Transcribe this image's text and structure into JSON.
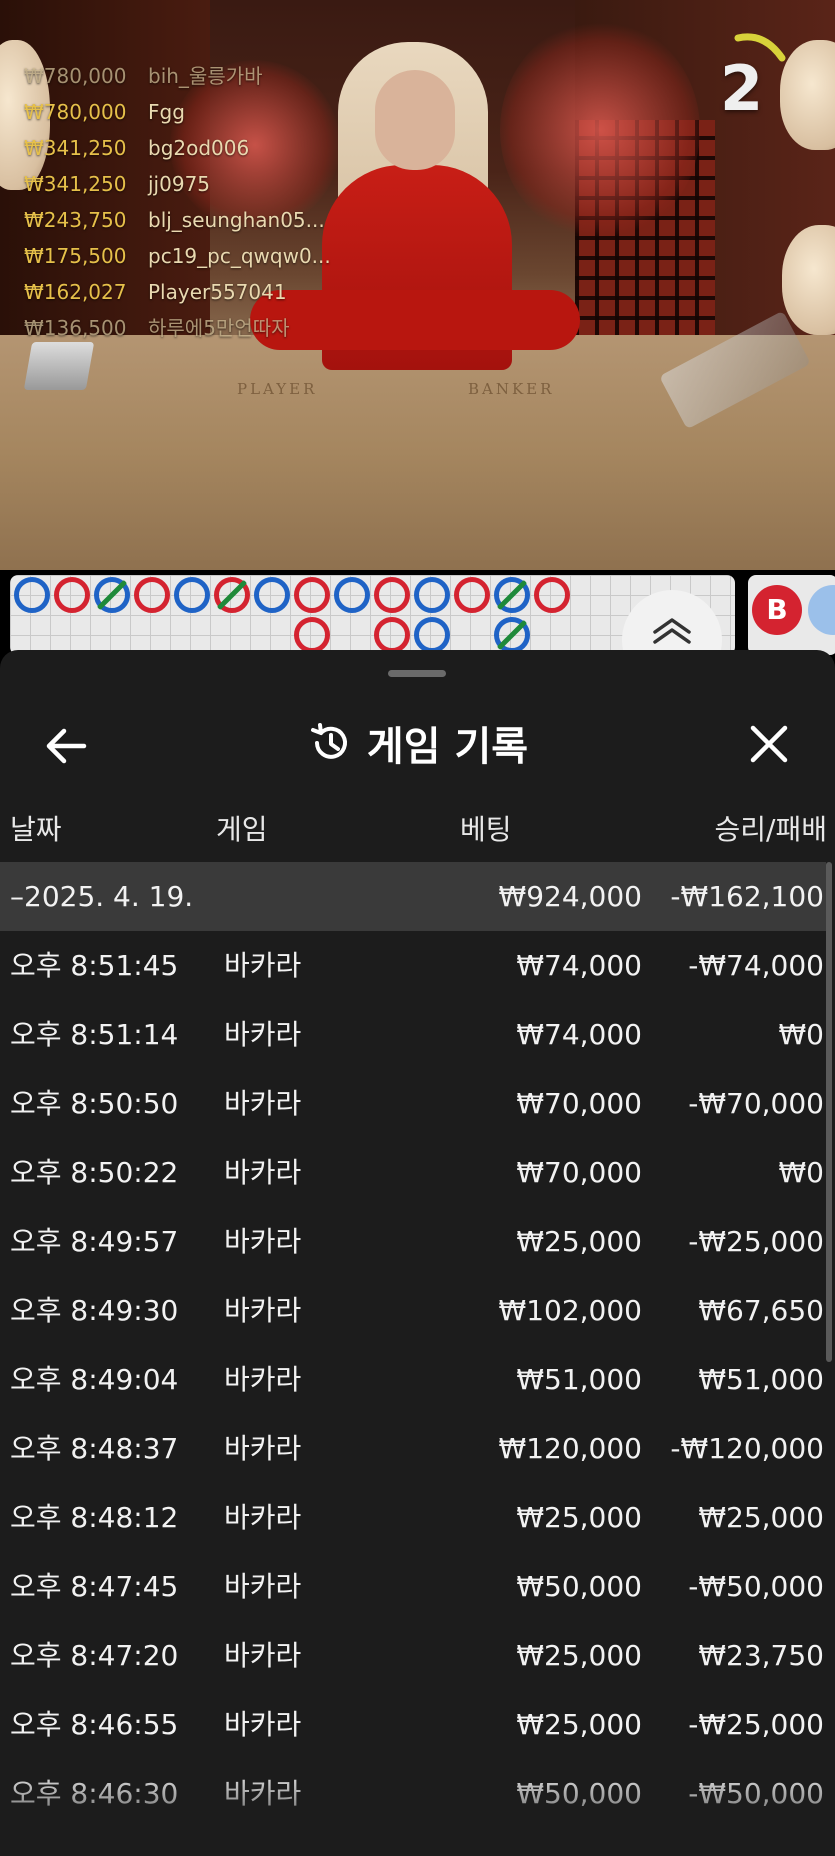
{
  "stream": {
    "countdown": "2",
    "table_labels": {
      "player": "PLAYER",
      "banker": "BANKER"
    },
    "leaderboard": [
      {
        "amount": "₩780,000",
        "name": "bih_울릉가바",
        "dim": true
      },
      {
        "amount": "₩780,000",
        "name": "Fgg",
        "dim": false
      },
      {
        "amount": "₩341,250",
        "name": "bg2od006",
        "dim": false
      },
      {
        "amount": "₩341,250",
        "name": "jj0975",
        "dim": false
      },
      {
        "amount": "₩243,750",
        "name": "blj_seunghan05...",
        "dim": false
      },
      {
        "amount": "₩175,500",
        "name": "pc19_pc_qwqw0...",
        "dim": false
      },
      {
        "amount": "₩162,027",
        "name": "Player557041",
        "dim": false
      },
      {
        "amount": "₩136,500",
        "name": "하루에5만언따자",
        "dim": true
      }
    ],
    "road": {
      "top_row": [
        "p",
        "b",
        "p-tie",
        "b",
        "p",
        "b-tie",
        "p",
        "b",
        "p",
        "b",
        "p",
        "b",
        "p-tie",
        "b"
      ],
      "second_row": [
        "",
        "",
        "",
        "",
        "",
        "",
        "",
        "b",
        "",
        "b",
        "p",
        "",
        "p-tie",
        ""
      ],
      "banker_chip_label": "B"
    }
  },
  "history": {
    "title": "게임 기록",
    "icons": {
      "back": "arrow-left-icon",
      "history": "history-clock-icon",
      "close": "close-icon"
    },
    "columns": {
      "date": "날짜",
      "game": "게임",
      "bet": "베팅",
      "result": "승리/패배"
    },
    "group": {
      "date": "–2025. 4. 19.",
      "bet": "₩924,000",
      "result": "-₩162,100"
    },
    "rows": [
      {
        "time": "오후 8:51:45",
        "game": "바카라",
        "bet": "₩74,000",
        "result": "-₩74,000"
      },
      {
        "time": "오후 8:51:14",
        "game": "바카라",
        "bet": "₩74,000",
        "result": "₩0"
      },
      {
        "time": "오후 8:50:50",
        "game": "바카라",
        "bet": "₩70,000",
        "result": "-₩70,000"
      },
      {
        "time": "오후 8:50:22",
        "game": "바카라",
        "bet": "₩70,000",
        "result": "₩0"
      },
      {
        "time": "오후 8:49:57",
        "game": "바카라",
        "bet": "₩25,000",
        "result": "-₩25,000"
      },
      {
        "time": "오후 8:49:30",
        "game": "바카라",
        "bet": "₩102,000",
        "result": "₩67,650"
      },
      {
        "time": "오후 8:49:04",
        "game": "바카라",
        "bet": "₩51,000",
        "result": "₩51,000"
      },
      {
        "time": "오후 8:48:37",
        "game": "바카라",
        "bet": "₩120,000",
        "result": "-₩120,000"
      },
      {
        "time": "오후 8:48:12",
        "game": "바카라",
        "bet": "₩25,000",
        "result": "₩25,000"
      },
      {
        "time": "오후 8:47:45",
        "game": "바카라",
        "bet": "₩50,000",
        "result": "-₩50,000"
      },
      {
        "time": "오후 8:47:20",
        "game": "바카라",
        "bet": "₩25,000",
        "result": "₩23,750"
      },
      {
        "time": "오후 8:46:55",
        "game": "바카라",
        "bet": "₩25,000",
        "result": "-₩25,000"
      },
      {
        "time": "오후 8:46:30",
        "game": "바카라",
        "bet": "₩50,000",
        "result": "-₩50,000"
      }
    ]
  }
}
